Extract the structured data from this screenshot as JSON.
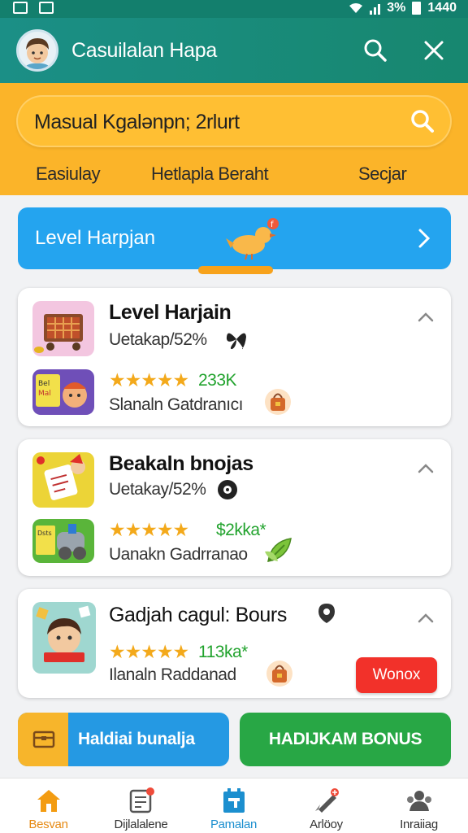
{
  "status_bar": {
    "battery": "3%",
    "time": "1440"
  },
  "header": {
    "title": "Casuilalan Hapa",
    "search_icon": "search-icon",
    "close_icon": "close-icon"
  },
  "search": {
    "value": "Masual Kgalənpn; 2rlurt",
    "icon": "search-icon"
  },
  "filter_tabs": [
    {
      "label": "Easiulay"
    },
    {
      "label": "Hetlapla Beraht"
    },
    {
      "label": "Secjar"
    }
  ],
  "level_banner": {
    "label": "Level Harpjan",
    "icon": "bird-icon",
    "progress": 0.35
  },
  "cards": [
    {
      "title": "Level Harjain",
      "subtitle": "Uetakap/52%",
      "subtitle_icon": "butterfly-icon",
      "stars": "★★★★★",
      "rating": "233K",
      "description": "Slanaln Gatdranıcı",
      "action_icon": "bag-icon"
    },
    {
      "title": "Beakaln bnojas",
      "subtitle": "Uetakay/52%",
      "subtitle_icon": "record-icon",
      "stars": "★★★★★",
      "rating": "$2kka*",
      "description": "Uanakn Gadrranao",
      "action_icon": "leaf-icon"
    },
    {
      "title": "Gadjah cagul: Bours",
      "title_icon": "pin-icon",
      "stars": "★★★★★",
      "rating": "113ka*",
      "description": "Ilanaln Raddanad",
      "action_icon": "bag-icon",
      "tag": "Wonox"
    }
  ],
  "buttons": {
    "primary": "Haldiai bunalja",
    "secondary": "HADIJKAM BONUS"
  },
  "bottom_nav": [
    {
      "label": "Besvan",
      "icon": "home-icon"
    },
    {
      "label": "Dijlalalene",
      "icon": "list-icon"
    },
    {
      "label": "Pamalan",
      "icon": "calendar-icon"
    },
    {
      "label": "Arlöoy",
      "icon": "rocket-icon"
    },
    {
      "label": "Inraiiag",
      "icon": "people-icon"
    }
  ],
  "colors": {
    "header": "#1b8f86",
    "search_band": "#fbb429",
    "banner": "#24a4ef",
    "star": "#f3a91b",
    "rating": "#22a32e",
    "tag": "#f2312a",
    "button_blue": "#2599e3",
    "button_green": "#28a745"
  }
}
